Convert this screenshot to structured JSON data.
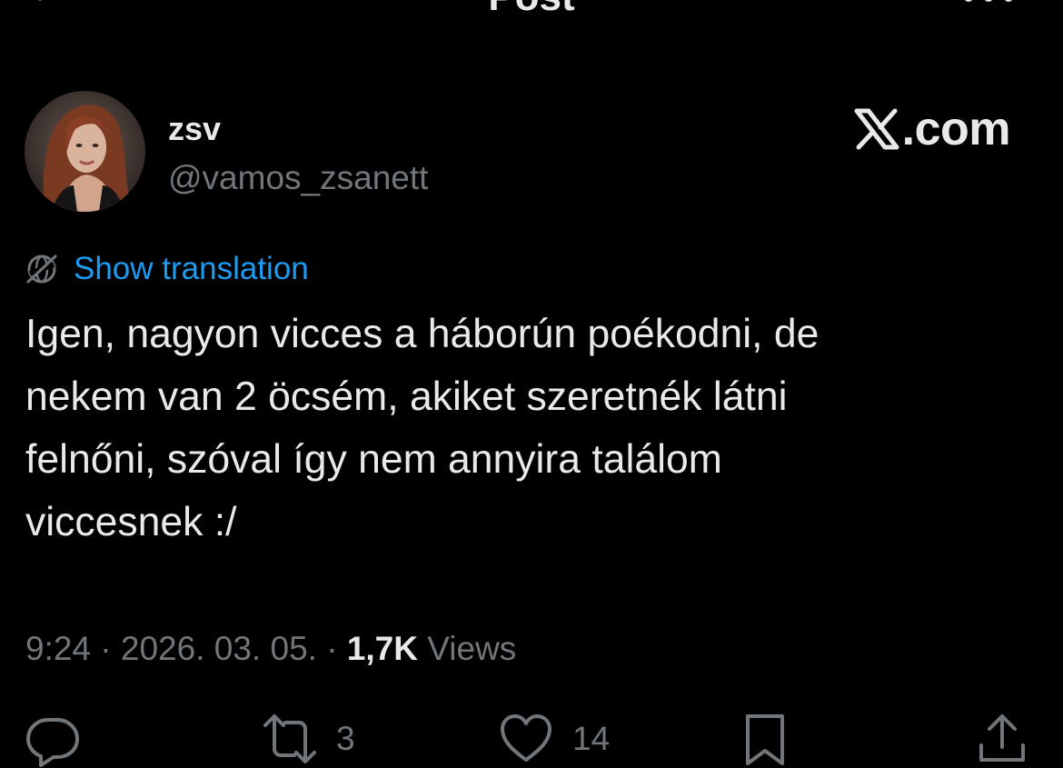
{
  "header": {
    "title": "Post",
    "back_icon": "back-arrow-icon",
    "more_icon": "more-dots-icon"
  },
  "author": {
    "display_name": "zsv",
    "handle": "@vamos_zsanett"
  },
  "brand": {
    "text": ".com"
  },
  "translation": {
    "label": "Show translation",
    "icon": "translate-globe-icon"
  },
  "post": {
    "text": "Igen, nagyon vicces a háborún poékodni, de\nnekem van 2 öcsém, akiket szeretnék látni\nfelnőni, szóval így nem annyira találom\nviccesnek :/"
  },
  "meta": {
    "time": "9:24",
    "separator": " · ",
    "date": "2026. 03. 05.",
    "views_count": "1,7K",
    "views_label": "Views"
  },
  "actions": {
    "reply": {
      "icon": "reply-icon",
      "count": ""
    },
    "repost": {
      "icon": "repost-icon",
      "count": "3"
    },
    "like": {
      "icon": "like-icon",
      "count": "14"
    },
    "bookmark": {
      "icon": "bookmark-icon",
      "count": ""
    },
    "share": {
      "icon": "share-icon",
      "count": ""
    }
  },
  "colors": {
    "background": "#000000",
    "text": "#e7e9ea",
    "secondary": "#71767b",
    "link": "#1d9bf0"
  }
}
